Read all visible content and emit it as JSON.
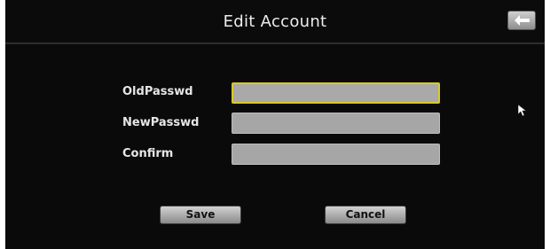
{
  "header": {
    "title": "Edit Account",
    "back_icon": "back-arrow-icon"
  },
  "form": {
    "fields": [
      {
        "label": "OldPasswd",
        "value": "",
        "focused": true
      },
      {
        "label": "NewPasswd",
        "value": ""
      },
      {
        "label": "Confirm",
        "value": ""
      }
    ]
  },
  "buttons": {
    "save_label": "Save",
    "cancel_label": "Cancel"
  },
  "colors": {
    "focus_border": "#d8c928",
    "background": "#0a0a0a",
    "input_fill": "#a6a6a6"
  }
}
